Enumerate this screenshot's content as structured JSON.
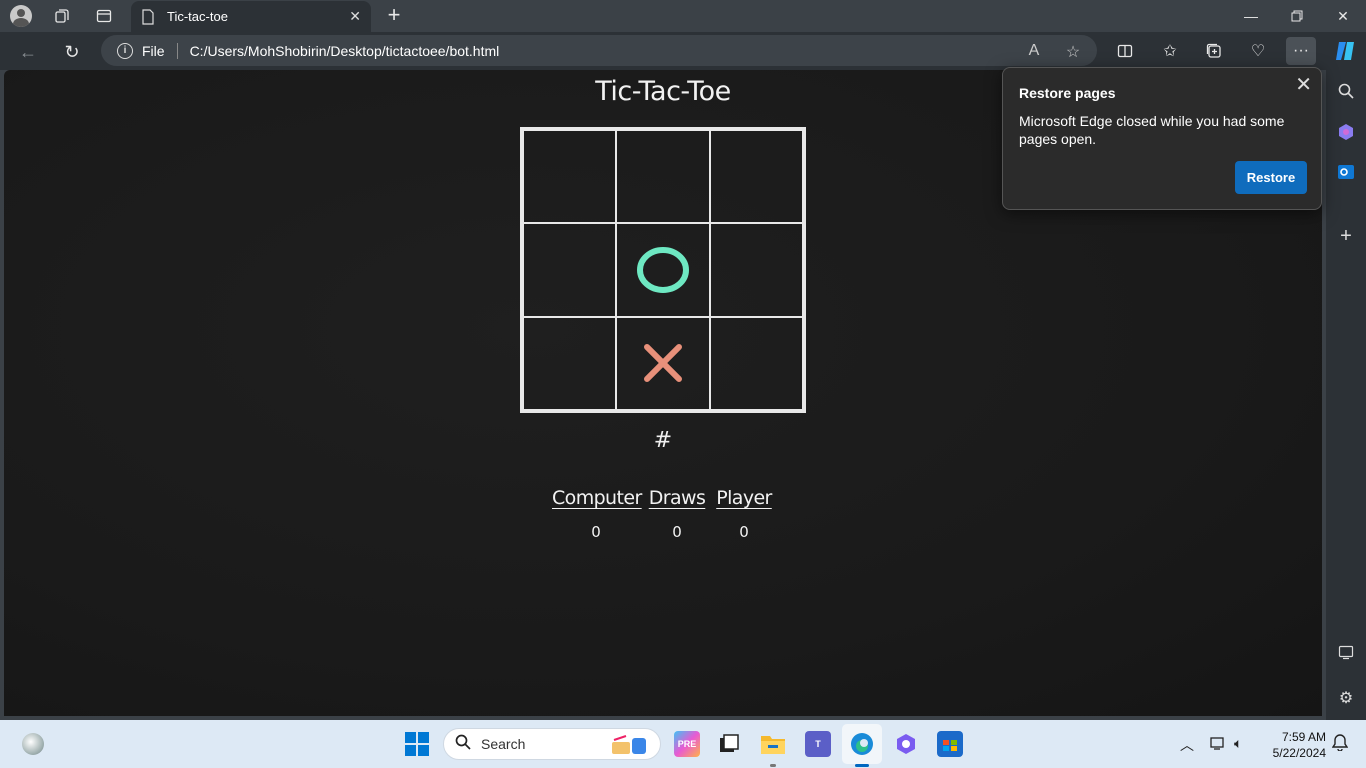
{
  "browser": {
    "tab_title": "Tic-tac-toe",
    "address_scheme": "File",
    "address_url": "C:/Users/MohShobirin/Desktop/tictactoee/bot.html"
  },
  "game": {
    "title": "Tic-Tac-Toe",
    "board": [
      "",
      "",
      "",
      "",
      "O",
      "",
      "",
      "X",
      ""
    ],
    "turn_symbol": "#",
    "o_color": "#6ee8c2",
    "x_color": "#e8907a",
    "scores": [
      {
        "label": "Computer",
        "value": "0"
      },
      {
        "label": "Draws",
        "value": "0"
      },
      {
        "label": "Player",
        "value": "0"
      }
    ]
  },
  "popup": {
    "title": "Restore pages",
    "message": "Microsoft Edge closed while you had some pages open.",
    "button": "Restore"
  },
  "taskbar": {
    "search_placeholder": "Search",
    "time": "7:59 AM",
    "date": "5/22/2024"
  }
}
